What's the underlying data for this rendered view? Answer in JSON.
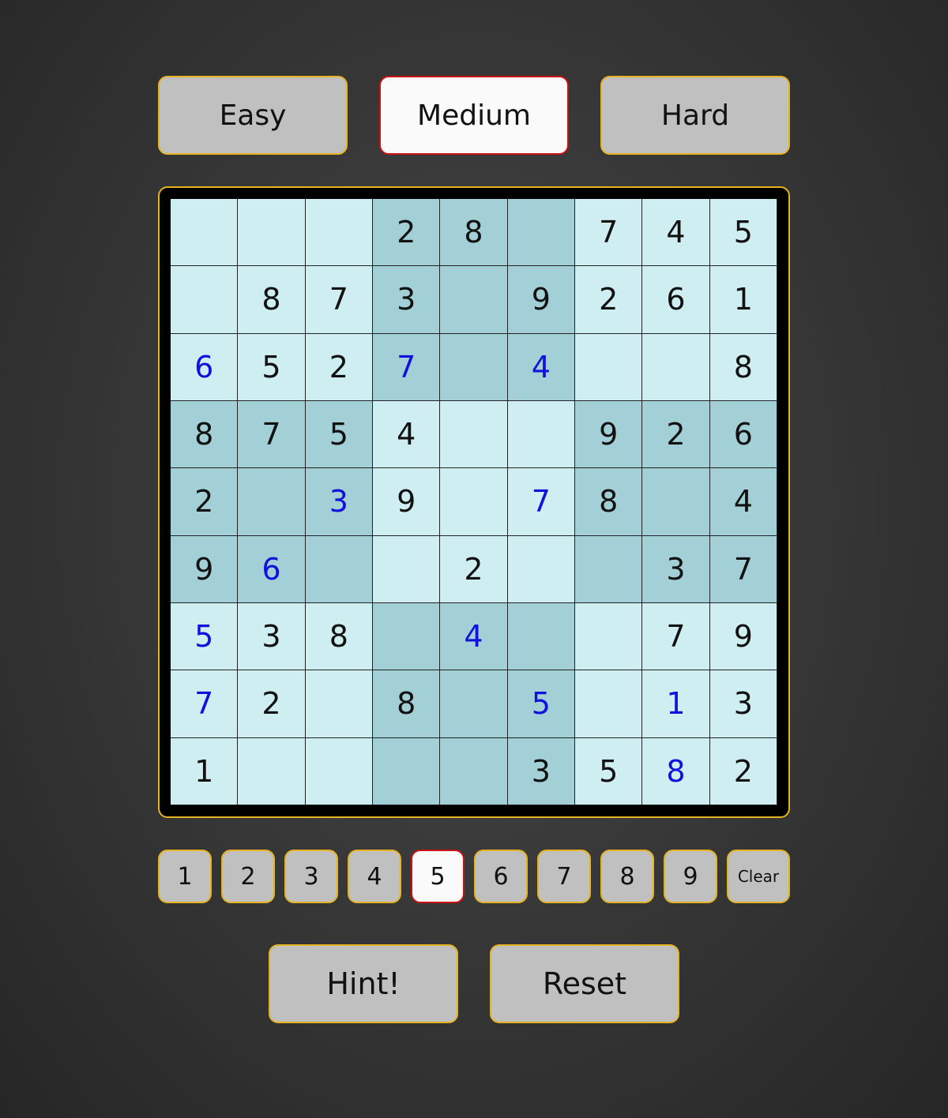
{
  "difficulty": {
    "options": [
      "Easy",
      "Medium",
      "Hard"
    ],
    "selected": 1
  },
  "board": {
    "cells": [
      [
        "",
        "",
        "",
        "2",
        "8",
        "",
        "7",
        "4",
        "5"
      ],
      [
        "",
        "8",
        "7",
        "3",
        "",
        "9",
        "2",
        "6",
        "1"
      ],
      [
        "6",
        "5",
        "2",
        "7",
        "",
        "4",
        "",
        "",
        "8"
      ],
      [
        "8",
        "7",
        "5",
        "4",
        "",
        "",
        "9",
        "2",
        "6"
      ],
      [
        "2",
        "",
        "3",
        "9",
        "",
        "7",
        "8",
        "",
        "4"
      ],
      [
        "9",
        "6",
        "",
        "",
        "2",
        "",
        "",
        "3",
        "7"
      ],
      [
        "5",
        "3",
        "8",
        "",
        "4",
        "",
        "",
        "7",
        "9"
      ],
      [
        "7",
        "2",
        "",
        "8",
        "",
        "5",
        "",
        "1",
        "3"
      ],
      [
        "1",
        "",
        "",
        "",
        "",
        "3",
        "5",
        "8",
        "2"
      ]
    ],
    "user_entered": [
      [
        false,
        false,
        false,
        false,
        false,
        false,
        false,
        false,
        false
      ],
      [
        false,
        false,
        false,
        false,
        false,
        false,
        false,
        false,
        false
      ],
      [
        true,
        false,
        false,
        true,
        false,
        true,
        false,
        false,
        false
      ],
      [
        false,
        false,
        false,
        false,
        false,
        false,
        false,
        false,
        false
      ],
      [
        false,
        false,
        true,
        false,
        false,
        true,
        false,
        false,
        false
      ],
      [
        false,
        true,
        false,
        false,
        false,
        false,
        false,
        false,
        false
      ],
      [
        true,
        false,
        false,
        false,
        true,
        false,
        false,
        false,
        false
      ],
      [
        true,
        false,
        false,
        false,
        false,
        true,
        false,
        true,
        false
      ],
      [
        false,
        false,
        false,
        false,
        false,
        false,
        false,
        true,
        false
      ]
    ]
  },
  "number_pad": {
    "numbers": [
      "1",
      "2",
      "3",
      "4",
      "5",
      "6",
      "7",
      "8",
      "9"
    ],
    "selected": "5",
    "clear_label": "Clear"
  },
  "actions": {
    "hint_label": "Hint!",
    "reset_label": "Reset"
  },
  "colors": {
    "light_cell": "#cfeef1",
    "dark_cell": "#a2d0d6",
    "user_digit": "#1111dd",
    "given_digit": "#111111",
    "button_border": "#e6b422",
    "selected_border": "#cc1111"
  }
}
